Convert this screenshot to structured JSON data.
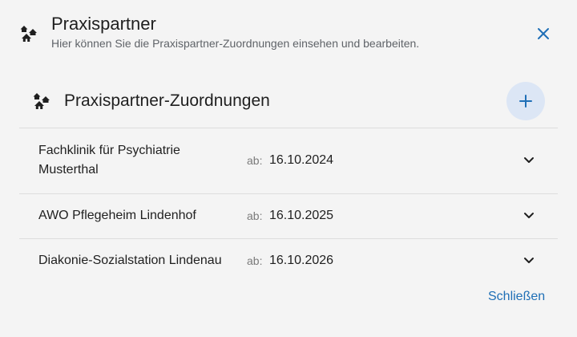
{
  "dialog": {
    "title": "Praxispartner",
    "subtitle": "Hier können Sie die Praxispartner-Zuordnungen einsehen und bearbeiten.",
    "header_icon": "house-group-icon",
    "close_icon": "close-icon"
  },
  "section": {
    "title": "Praxispartner-Zuordnungen",
    "icon": "house-group-icon",
    "add_icon": "plus-icon"
  },
  "partners": [
    {
      "name": "Fachklinik für Psychiatrie Musterthal",
      "ab_label": "ab:",
      "date": "16.10.2024"
    },
    {
      "name": "AWO Pflegeheim Lindenhof",
      "ab_label": "ab:",
      "date": "16.10.2025"
    },
    {
      "name": "Diakonie-Sozialstation Lindenau",
      "ab_label": "ab:",
      "date": "16.10.2026"
    }
  ],
  "footer": {
    "close_label": "Schließen"
  },
  "colors": {
    "accent": "#1f6fb6",
    "add_button_bg": "#dce6f5",
    "background": "#f4f4f4",
    "divider": "#dddddd"
  }
}
